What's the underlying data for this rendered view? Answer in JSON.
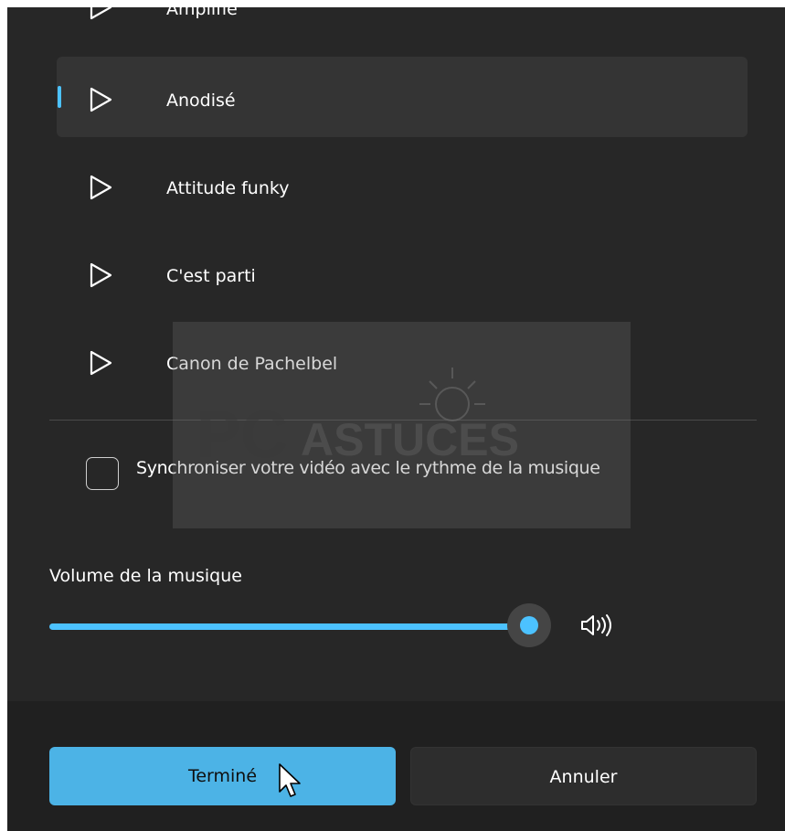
{
  "colors": {
    "window_bg": "#272727",
    "footer_bg": "#202020",
    "accent": "#4cc2ff",
    "primary_button": "#4cb3e6",
    "selected_row": "#343434"
  },
  "tracks": [
    {
      "label": "Amplifié",
      "selected": false
    },
    {
      "label": "Anodisé",
      "selected": true
    },
    {
      "label": "Attitude funky",
      "selected": false
    },
    {
      "label": "C'est parti",
      "selected": false
    },
    {
      "label": "Canon de Pachelbel",
      "selected": false
    }
  ],
  "sync": {
    "label": "Synchroniser votre vidéo avec le rythme de la musique",
    "checked": false
  },
  "volume": {
    "label": "Volume de la musique",
    "level_percent": 100,
    "icon": "speaker-icon"
  },
  "buttons": {
    "done_label": "Terminé",
    "cancel_label": "Annuler"
  },
  "watermark": {
    "text": "PC ASTUCES"
  }
}
